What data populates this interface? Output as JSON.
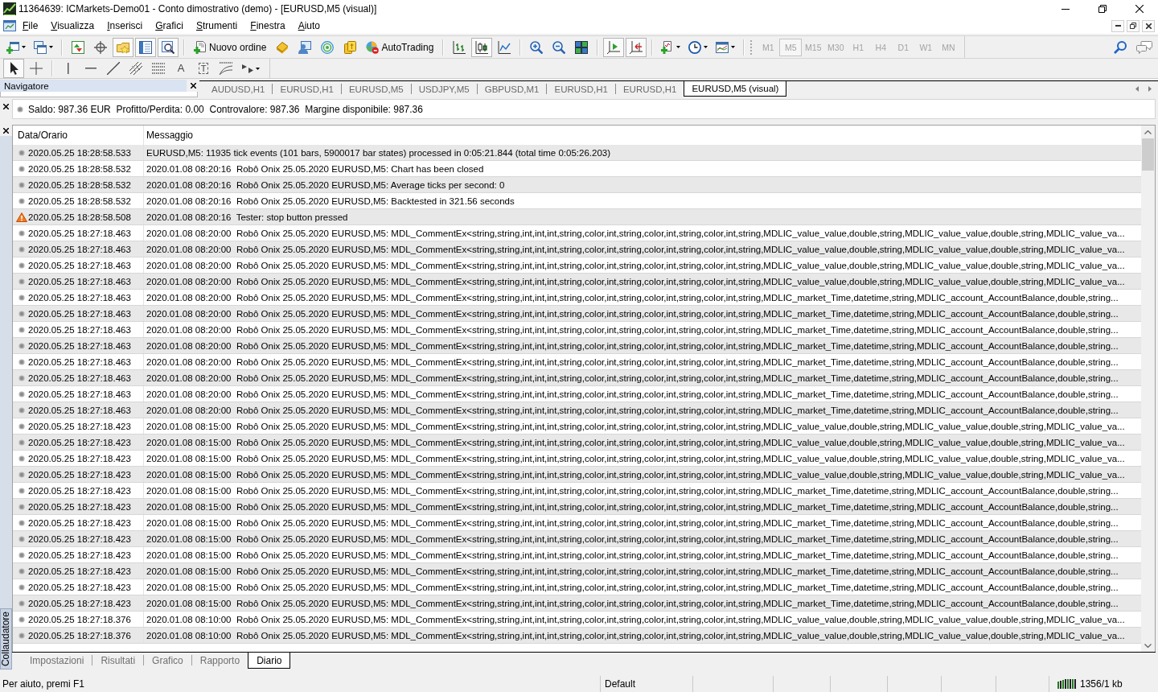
{
  "window": {
    "title": "11364639: ICMarkets-Demo01 - Conto dimostrativo (demo) - [EURUSD,M5 (visual)]"
  },
  "menu": [
    "File",
    "Visualizza",
    "Inserisci",
    "Grafici",
    "Strumenti",
    "Finestra",
    "Aiuto"
  ],
  "main_toolbar": {
    "groups": [
      [
        {
          "pressed": false
        },
        {
          "pressed": false
        }
      ],
      [
        {
          "pressed": false
        },
        {
          "pressed": false
        },
        {
          "pressed": true
        },
        {
          "pressed": true
        },
        {
          "pressed": true
        }
      ],
      [
        {
          "label": "Nuovo ordine",
          "pressed": false
        },
        {
          "pressed": false
        },
        {
          "pressed": false
        },
        {
          "pressed": false
        },
        {
          "pressed": false
        },
        {
          "label": "AutoTrading",
          "pressed": false
        }
      ],
      [
        {
          "pressed": false
        },
        {
          "pressed": true
        },
        {
          "pressed": false
        }
      ],
      [
        {
          "pressed": false
        },
        {
          "pressed": false
        },
        {
          "pressed": false
        }
      ],
      [
        {
          "pressed": true
        },
        {
          "pressed": true
        }
      ],
      [
        {
          "pressed": false
        },
        {
          "pressed": false
        },
        {
          "pressed": false
        }
      ]
    ],
    "timeframes": {
      "disabled": true,
      "items": [
        {
          "label": "M1",
          "selected": false
        },
        {
          "label": "M5",
          "selected": true
        },
        {
          "label": "M15",
          "selected": false
        },
        {
          "label": "M30",
          "selected": false
        },
        {
          "label": "H1",
          "selected": false
        },
        {
          "label": "H4",
          "selected": false
        },
        {
          "label": "D1",
          "selected": false
        },
        {
          "label": "W1",
          "selected": false
        },
        {
          "label": "MN",
          "selected": false
        }
      ]
    }
  },
  "drawing_toolbar": {
    "groups": [
      [
        {
          "pressed": true
        },
        {
          "pressed": false
        }
      ],
      [
        {
          "pressed": false
        },
        {
          "pressed": false
        },
        {
          "pressed": false
        },
        {
          "pressed": false
        },
        {
          "pressed": false
        },
        {
          "pressed": false,
          "glyph": "A"
        },
        {
          "pressed": false,
          "glyph": "T"
        },
        {
          "pressed": false
        },
        {
          "pressed": false
        }
      ]
    ]
  },
  "navigator": {
    "title": "Navigatore"
  },
  "chart_tabs": [
    {
      "label": "AUDUSD,H1",
      "selected": false
    },
    {
      "label": "EURUSD,H1",
      "selected": false
    },
    {
      "label": "EURUSD,M5",
      "selected": false
    },
    {
      "label": "USDJPY,M5",
      "selected": false
    },
    {
      "label": "GBPUSD,M1",
      "selected": false
    },
    {
      "label": "EURUSD,H1",
      "selected": false
    },
    {
      "label": "EURUSD,H1",
      "selected": false
    },
    {
      "label": "EURUSD,M5 (visual)",
      "selected": true
    }
  ],
  "account_bar": {
    "text": "Saldo: 987.36 EUR  Profitto/Perdita: 0.00  Controvalore: 987.36  Margine disponibile: 987.36"
  },
  "tester_panel": {
    "title": "Collaudatore",
    "journal": {
      "columns": [
        "Data/Orario",
        "Messaggio"
      ],
      "rows": [
        {
          "kind": "info",
          "time": "2020.05.25 18:28:58.533",
          "message": "EURUSD,M5: 11935 tick events (101 bars, 5900017 bar states) processed in 0:05:21.844 (total time 0:05:26.203)"
        },
        {
          "kind": "info",
          "time": "2020.05.25 18:28:58.532",
          "message": "2020.01.08 08:20:16  Robô Onix 25.05.2020 EURUSD,M5: Chart has been closed"
        },
        {
          "kind": "info",
          "time": "2020.05.25 18:28:58.532",
          "message": "2020.01.08 08:20:16  Robô Onix 25.05.2020 EURUSD,M5: Average ticks per second: 0"
        },
        {
          "kind": "info",
          "time": "2020.05.25 18:28:58.532",
          "message": "2020.01.08 08:20:16  Robô Onix 25.05.2020 EURUSD,M5: Backtested in 321.56 seconds"
        },
        {
          "kind": "warning",
          "time": "2020.05.25 18:28:58.508",
          "message": "2020.01.08 08:20:16  Tester: stop button pressed"
        },
        {
          "kind": "info",
          "time": "2020.05.25 18:27:18.463",
          "message": "2020.01.08 08:20:00  Robô Onix 25.05.2020 EURUSD,M5: MDL_CommentEx<string,string,int,int,int,string,color,int,string,color,int,string,color,int,string,MDLIC_value_value,double,string,MDLIC_value_value,double,string,MDLIC_value_va..."
        },
        {
          "kind": "info",
          "time": "2020.05.25 18:27:18.463",
          "message": "2020.01.08 08:20:00  Robô Onix 25.05.2020 EURUSD,M5: MDL_CommentEx<string,string,int,int,int,string,color,int,string,color,int,string,color,int,string,MDLIC_value_value,double,string,MDLIC_value_value,double,string,MDLIC_value_va..."
        },
        {
          "kind": "info",
          "time": "2020.05.25 18:27:18.463",
          "message": "2020.01.08 08:20:00  Robô Onix 25.05.2020 EURUSD,M5: MDL_CommentEx<string,string,int,int,int,string,color,int,string,color,int,string,color,int,string,MDLIC_value_value,double,string,MDLIC_value_value,double,string,MDLIC_value_va..."
        },
        {
          "kind": "info",
          "time": "2020.05.25 18:27:18.463",
          "message": "2020.01.08 08:20:00  Robô Onix 25.05.2020 EURUSD,M5: MDL_CommentEx<string,string,int,int,int,string,color,int,string,color,int,string,color,int,string,MDLIC_value_value,double,string,MDLIC_value_value,double,string,MDLIC_value_va..."
        },
        {
          "kind": "info",
          "time": "2020.05.25 18:27:18.463",
          "message": "2020.01.08 08:20:00  Robô Onix 25.05.2020 EURUSD,M5: MDL_CommentEx<string,string,int,int,int,string,color,int,string,color,int,string,color,int,string,MDLIC_market_Time,datetime,string,MDLIC_account_AccountBalance,double,string..."
        },
        {
          "kind": "info",
          "time": "2020.05.25 18:27:18.463",
          "message": "2020.01.08 08:20:00  Robô Onix 25.05.2020 EURUSD,M5: MDL_CommentEx<string,string,int,int,int,string,color,int,string,color,int,string,color,int,string,MDLIC_market_Time,datetime,string,MDLIC_account_AccountBalance,double,string..."
        },
        {
          "kind": "info",
          "time": "2020.05.25 18:27:18.463",
          "message": "2020.01.08 08:20:00  Robô Onix 25.05.2020 EURUSD,M5: MDL_CommentEx<string,string,int,int,int,string,color,int,string,color,int,string,color,int,string,MDLIC_market_Time,datetime,string,MDLIC_account_AccountBalance,double,string..."
        },
        {
          "kind": "info",
          "time": "2020.05.25 18:27:18.463",
          "message": "2020.01.08 08:20:00  Robô Onix 25.05.2020 EURUSD,M5: MDL_CommentEx<string,string,int,int,int,string,color,int,string,color,int,string,color,int,string,MDLIC_market_Time,datetime,string,MDLIC_account_AccountBalance,double,string..."
        },
        {
          "kind": "info",
          "time": "2020.05.25 18:27:18.463",
          "message": "2020.01.08 08:20:00  Robô Onix 25.05.2020 EURUSD,M5: MDL_CommentEx<string,string,int,int,int,string,color,int,string,color,int,string,color,int,string,MDLIC_market_Time,datetime,string,MDLIC_account_AccountBalance,double,string..."
        },
        {
          "kind": "info",
          "time": "2020.05.25 18:27:18.463",
          "message": "2020.01.08 08:20:00  Robô Onix 25.05.2020 EURUSD,M5: MDL_CommentEx<string,string,int,int,int,string,color,int,string,color,int,string,color,int,string,MDLIC_market_Time,datetime,string,MDLIC_account_AccountBalance,double,string..."
        },
        {
          "kind": "info",
          "time": "2020.05.25 18:27:18.463",
          "message": "2020.01.08 08:20:00  Robô Onix 25.05.2020 EURUSD,M5: MDL_CommentEx<string,string,int,int,int,string,color,int,string,color,int,string,color,int,string,MDLIC_market_Time,datetime,string,MDLIC_account_AccountBalance,double,string..."
        },
        {
          "kind": "info",
          "time": "2020.05.25 18:27:18.463",
          "message": "2020.01.08 08:20:00  Robô Onix 25.05.2020 EURUSD,M5: MDL_CommentEx<string,string,int,int,int,string,color,int,string,color,int,string,color,int,string,MDLIC_market_Time,datetime,string,MDLIC_account_AccountBalance,double,string..."
        },
        {
          "kind": "info",
          "time": "2020.05.25 18:27:18.423",
          "message": "2020.01.08 08:15:00  Robô Onix 25.05.2020 EURUSD,M5: MDL_CommentEx<string,string,int,int,int,string,color,int,string,color,int,string,color,int,string,MDLIC_value_value,double,string,MDLIC_value_value,double,string,MDLIC_value_va..."
        },
        {
          "kind": "info",
          "time": "2020.05.25 18:27:18.423",
          "message": "2020.01.08 08:15:00  Robô Onix 25.05.2020 EURUSD,M5: MDL_CommentEx<string,string,int,int,int,string,color,int,string,color,int,string,color,int,string,MDLIC_value_value,double,string,MDLIC_value_value,double,string,MDLIC_value_va..."
        },
        {
          "kind": "info",
          "time": "2020.05.25 18:27:18.423",
          "message": "2020.01.08 08:15:00  Robô Onix 25.05.2020 EURUSD,M5: MDL_CommentEx<string,string,int,int,int,string,color,int,string,color,int,string,color,int,string,MDLIC_value_value,double,string,MDLIC_value_value,double,string,MDLIC_value_va..."
        },
        {
          "kind": "info",
          "time": "2020.05.25 18:27:18.423",
          "message": "2020.01.08 08:15:00  Robô Onix 25.05.2020 EURUSD,M5: MDL_CommentEx<string,string,int,int,int,string,color,int,string,color,int,string,color,int,string,MDLIC_value_value,double,string,MDLIC_value_value,double,string,MDLIC_value_va..."
        },
        {
          "kind": "info",
          "time": "2020.05.25 18:27:18.423",
          "message": "2020.01.08 08:15:00  Robô Onix 25.05.2020 EURUSD,M5: MDL_CommentEx<string,string,int,int,int,string,color,int,string,color,int,string,color,int,string,MDLIC_market_Time,datetime,string,MDLIC_account_AccountBalance,double,string..."
        },
        {
          "kind": "info",
          "time": "2020.05.25 18:27:18.423",
          "message": "2020.01.08 08:15:00  Robô Onix 25.05.2020 EURUSD,M5: MDL_CommentEx<string,string,int,int,int,string,color,int,string,color,int,string,color,int,string,MDLIC_market_Time,datetime,string,MDLIC_account_AccountBalance,double,string..."
        },
        {
          "kind": "info",
          "time": "2020.05.25 18:27:18.423",
          "message": "2020.01.08 08:15:00  Robô Onix 25.05.2020 EURUSD,M5: MDL_CommentEx<string,string,int,int,int,string,color,int,string,color,int,string,color,int,string,MDLIC_market_Time,datetime,string,MDLIC_account_AccountBalance,double,string..."
        },
        {
          "kind": "info",
          "time": "2020.05.25 18:27:18.423",
          "message": "2020.01.08 08:15:00  Robô Onix 25.05.2020 EURUSD,M5: MDL_CommentEx<string,string,int,int,int,string,color,int,string,color,int,string,color,int,string,MDLIC_market_Time,datetime,string,MDLIC_account_AccountBalance,double,string..."
        },
        {
          "kind": "info",
          "time": "2020.05.25 18:27:18.423",
          "message": "2020.01.08 08:15:00  Robô Onix 25.05.2020 EURUSD,M5: MDL_CommentEx<string,string,int,int,int,string,color,int,string,color,int,string,color,int,string,MDLIC_market_Time,datetime,string,MDLIC_account_AccountBalance,double,string..."
        },
        {
          "kind": "info",
          "time": "2020.05.25 18:27:18.423",
          "message": "2020.01.08 08:15:00  Robô Onix 25.05.2020 EURUSD,M5: MDL_CommentEx<string,string,int,int,int,string,color,int,string,color,int,string,color,int,string,MDLIC_market_Time,datetime,string,MDLIC_account_AccountBalance,double,string..."
        },
        {
          "kind": "info",
          "time": "2020.05.25 18:27:18.423",
          "message": "2020.01.08 08:15:00  Robô Onix 25.05.2020 EURUSD,M5: MDL_CommentEx<string,string,int,int,int,string,color,int,string,color,int,string,color,int,string,MDLIC_market_Time,datetime,string,MDLIC_account_AccountBalance,double,string..."
        },
        {
          "kind": "info",
          "time": "2020.05.25 18:27:18.423",
          "message": "2020.01.08 08:15:00  Robô Onix 25.05.2020 EURUSD,M5: MDL_CommentEx<string,string,int,int,int,string,color,int,string,color,int,string,color,int,string,MDLIC_market_Time,datetime,string,MDLIC_account_AccountBalance,double,string..."
        },
        {
          "kind": "info",
          "time": "2020.05.25 18:27:18.376",
          "message": "2020.01.08 08:10:00  Robô Onix 25.05.2020 EURUSD,M5: MDL_CommentEx<string,string,int,int,int,string,color,int,string,color,int,string,color,int,string,MDLIC_value_value,double,string,MDLIC_value_value,double,string,MDLIC_value_va..."
        },
        {
          "kind": "info",
          "time": "2020.05.25 18:27:18.376",
          "message": "2020.01.08 08:10:00  Robô Onix 25.05.2020 EURUSD,M5: MDL_CommentEx<string,string,int,int,int,string,color,int,string,color,int,string,color,int,string,MDLIC_value_value,double,string,MDLIC_value_value,double,string,MDLIC_value_va..."
        }
      ]
    },
    "tabs": [
      {
        "label": "Impostazioni",
        "selected": false
      },
      {
        "label": "Risultati",
        "selected": false
      },
      {
        "label": "Grafico",
        "selected": false
      },
      {
        "label": "Rapporto",
        "selected": false
      },
      {
        "label": "Diario",
        "selected": true
      }
    ]
  },
  "status_bar": {
    "help": "Per aiuto, premi F1",
    "profile": "Default",
    "traffic": "1356/1 kb"
  }
}
